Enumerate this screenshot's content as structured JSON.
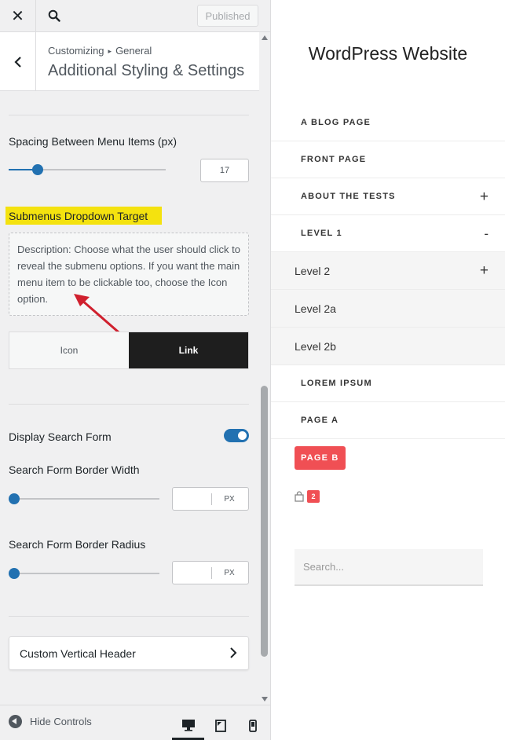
{
  "topbar": {
    "close_icon": "close-icon",
    "search_icon": "search-icon",
    "published_label": "Published"
  },
  "section": {
    "breadcrumb_root": "Customizing",
    "breadcrumb_sep": "▸",
    "breadcrumb_leaf": "General",
    "title": "Additional Styling & Settings"
  },
  "controls": {
    "menu_spacing": {
      "label": "Spacing Between Menu Items (px)",
      "value": "17",
      "slider_fraction": 0.18
    },
    "submenu_target": {
      "label": "Submenus Dropdown Target",
      "description": "Description: Choose what the user should click to reveal the submenu options. If you want the main menu item to be clickable too, choose the Icon option.",
      "options": [
        "Icon",
        "Link"
      ],
      "selected": "Link"
    },
    "display_search": {
      "label": "Display Search Form",
      "enabled": true
    },
    "border_width": {
      "label": "Search Form Border Width",
      "value": "",
      "unit": "PX",
      "slider_fraction": 0
    },
    "border_radius": {
      "label": "Search Form Border Radius",
      "value": "",
      "unit": "PX",
      "slider_fraction": 0
    },
    "vertical_header": {
      "label": "Custom Vertical Header"
    }
  },
  "footer": {
    "hide_controls_label": "Hide Controls",
    "devices": [
      "desktop-icon",
      "tablet-icon",
      "mobile-icon"
    ],
    "active_device": "desktop-icon"
  },
  "preview": {
    "site_title": "WordPress Website",
    "menu": [
      {
        "label": "A BLOG PAGE",
        "level": 1,
        "toggle": ""
      },
      {
        "label": "FRONT PAGE",
        "level": 1,
        "toggle": ""
      },
      {
        "label": "ABOUT THE TESTS",
        "level": 1,
        "toggle": "+"
      },
      {
        "label": "LEVEL 1",
        "level": 1,
        "toggle": "-"
      },
      {
        "label": "Level 2",
        "level": 2,
        "toggle": "+"
      },
      {
        "label": "Level 2a",
        "level": 2,
        "toggle": ""
      },
      {
        "label": "Level 2b",
        "level": 2,
        "toggle": ""
      },
      {
        "label": "LOREM IPSUM",
        "level": 1,
        "toggle": ""
      },
      {
        "label": "PAGE A",
        "level": 1,
        "toggle": ""
      },
      {
        "label": "PAGE B",
        "level": 1,
        "toggle": "",
        "highlighted": true
      }
    ],
    "cart_count": "2",
    "search_placeholder": "Search..."
  },
  "colors": {
    "accent": "#2271b1",
    "highlight": "#f4e20f",
    "arrow": "#d0202e",
    "menu_button": "#f04f54"
  }
}
